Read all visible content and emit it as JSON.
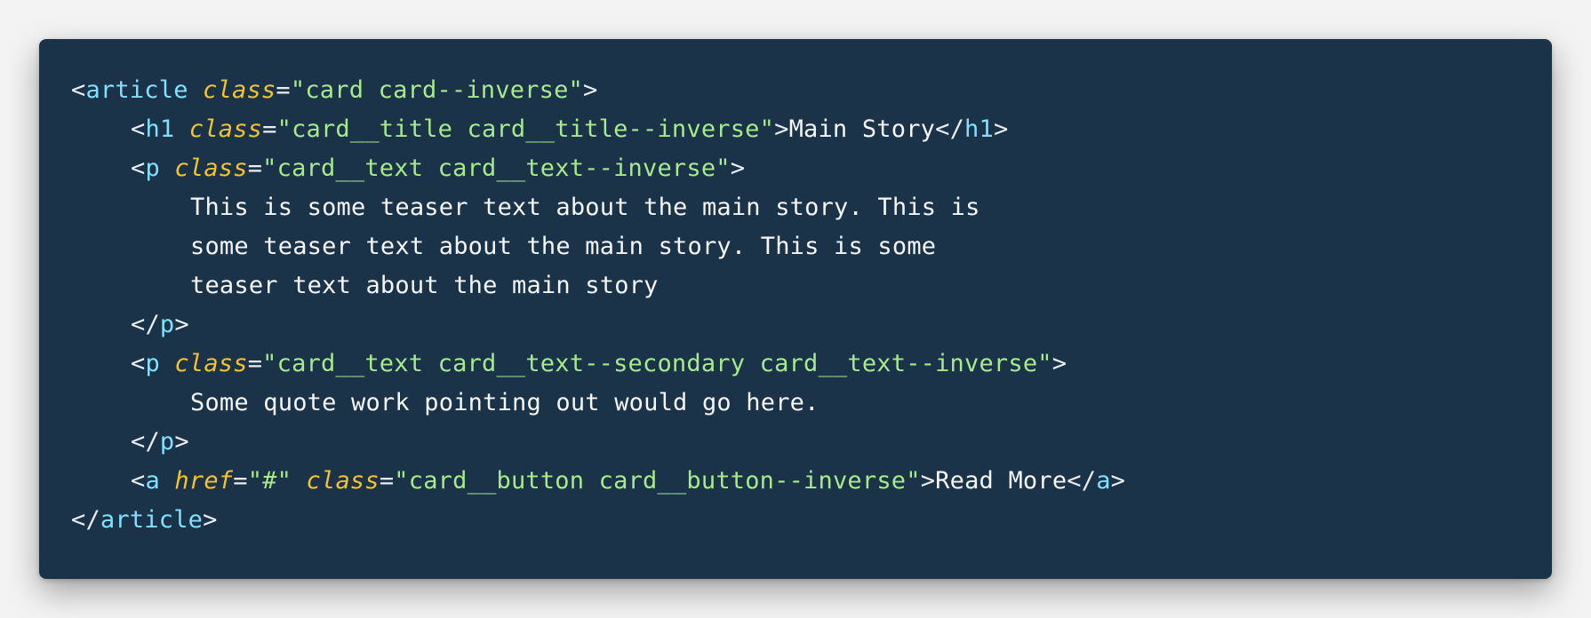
{
  "colors": {
    "page_background": "#f3f3f3",
    "panel_background": "#1b3349",
    "tag_color": "#7fe0ff",
    "attribute_color": "#f2c230",
    "string_color": "#a6ea8c",
    "text_color": "#f4f6f8"
  },
  "code": {
    "l1": {
      "lt": "<",
      "tag": "article",
      "attr1": "class",
      "eq": "=",
      "val1": "\"card card--inverse\"",
      "gt": ">"
    },
    "l2": {
      "lt": "<",
      "tag": "h1",
      "attr1": "class",
      "eq": "=",
      "val1": "\"card__title card__title--inverse\"",
      "gt": ">",
      "text": "Main Story",
      "close_lt": "</",
      "close_tag": "h1",
      "close_gt": ">"
    },
    "l3": {
      "lt": "<",
      "tag": "p",
      "attr1": "class",
      "eq": "=",
      "val1": "\"card__text card__text--inverse\"",
      "gt": ">"
    },
    "l4": {
      "text": "This is some teaser text about the main story. This is"
    },
    "l5": {
      "text": "some teaser text about the main story. This is some"
    },
    "l6": {
      "text": "teaser text about the main story"
    },
    "l7": {
      "lt": "</",
      "tag": "p",
      "gt": ">"
    },
    "l8": {
      "lt": "<",
      "tag": "p",
      "attr1": "class",
      "eq": "=",
      "val1": "\"card__text card__text--secondary card__text--inverse\"",
      "gt": ">"
    },
    "l9": {
      "text": "Some quote work pointing out would go here."
    },
    "l10": {
      "lt": "</",
      "tag": "p",
      "gt": ">"
    },
    "l11": {
      "lt": "<",
      "tag": "a",
      "attr1": "href",
      "eq": "=",
      "val1": "\"#\"",
      "attr2": "class",
      "val2": "\"card__button card__button--inverse\"",
      "gt": ">",
      "text": "Read More",
      "close_lt": "</",
      "close_tag": "a",
      "close_gt": ">"
    },
    "l12": {
      "lt": "</",
      "tag": "article",
      "gt": ">"
    }
  }
}
